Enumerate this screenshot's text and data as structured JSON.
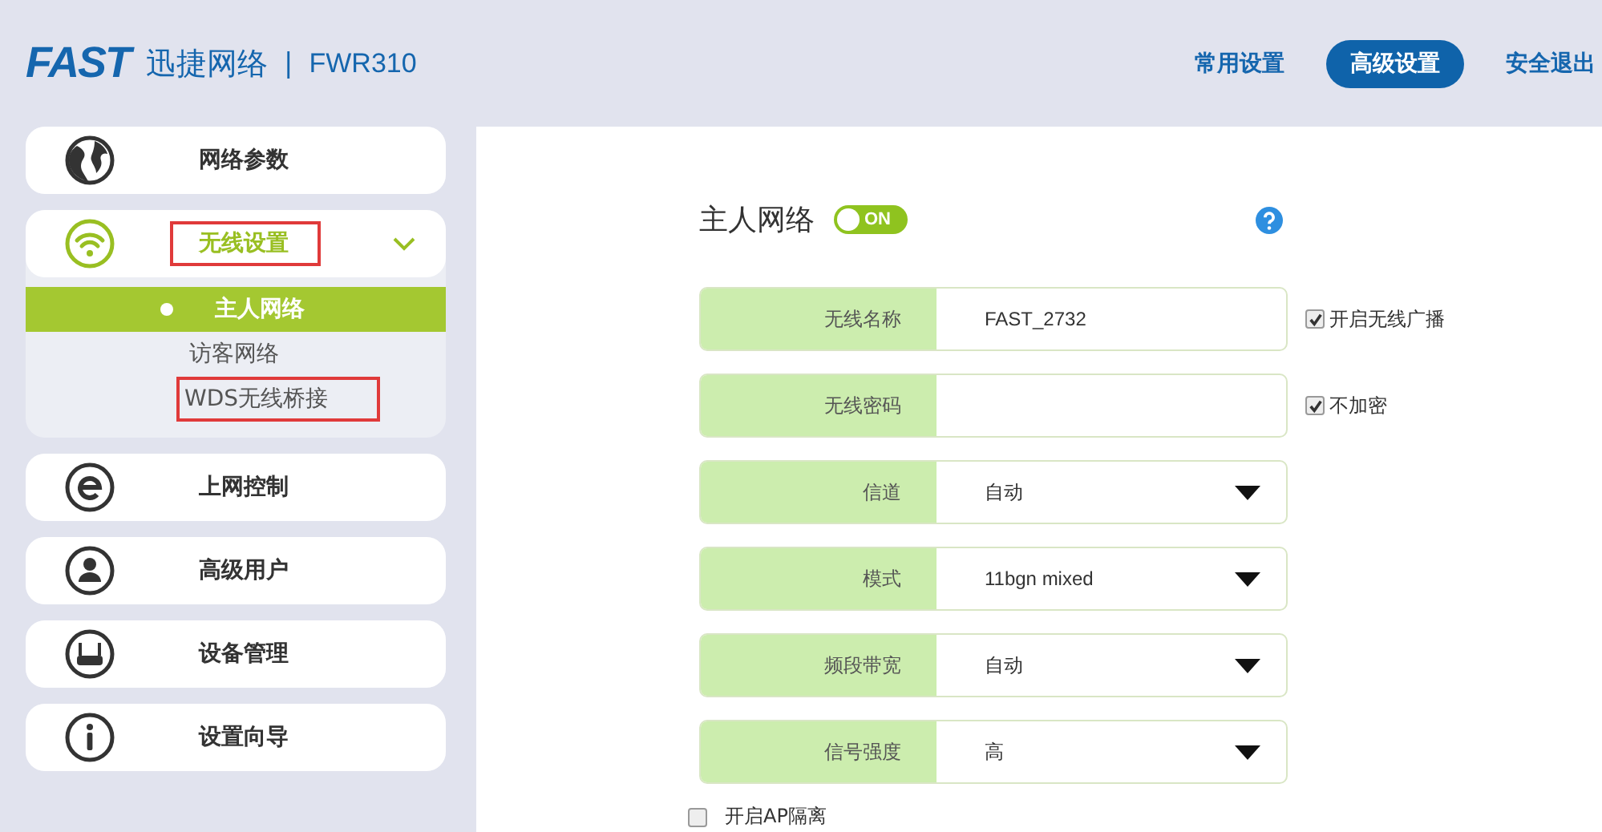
{
  "header": {
    "logo": "FAST",
    "brand": "迅捷网络",
    "separator": "|",
    "model": "FWR310",
    "nav": [
      {
        "label": "常用设置",
        "selected": false
      },
      {
        "label": "高级设置",
        "selected": true
      },
      {
        "label": "安全退出",
        "selected": false
      }
    ]
  },
  "sidebar": {
    "items": [
      {
        "label": "网络参数",
        "expanded": false,
        "highlighted": false
      },
      {
        "label": "无线设置",
        "expanded": true,
        "highlighted": true,
        "children": [
          {
            "label": "主人网络",
            "selected": true,
            "highlighted": false
          },
          {
            "label": "访客网络",
            "selected": false,
            "highlighted": false
          },
          {
            "label": "WDS无线桥接",
            "selected": false,
            "highlighted": true
          }
        ]
      },
      {
        "label": "上网控制",
        "expanded": false,
        "highlighted": false
      },
      {
        "label": "高级用户",
        "expanded": false,
        "highlighted": false
      },
      {
        "label": "设备管理",
        "expanded": false,
        "highlighted": false
      },
      {
        "label": "设置向导",
        "expanded": false,
        "highlighted": false
      }
    ]
  },
  "main": {
    "title": "主人网络",
    "toggle": {
      "label": "ON",
      "on": true
    },
    "fields": [
      {
        "kind": "text",
        "label": "无线名称",
        "value": "FAST_2732",
        "option": {
          "label": "开启无线广播",
          "checked": true
        }
      },
      {
        "kind": "text",
        "label": "无线密码",
        "option": {
          "label": "不加密",
          "checked": true
        }
      },
      {
        "kind": "select",
        "label": "信道",
        "value": "自动"
      },
      {
        "kind": "select",
        "label": "模式",
        "value": "11bgn mixed"
      },
      {
        "kind": "select",
        "label": "频段带宽",
        "value": "自动"
      },
      {
        "kind": "select",
        "label": "信号强度",
        "value": "高"
      }
    ],
    "footer_option": {
      "label": "开启AP隔离",
      "checked": false
    }
  }
}
